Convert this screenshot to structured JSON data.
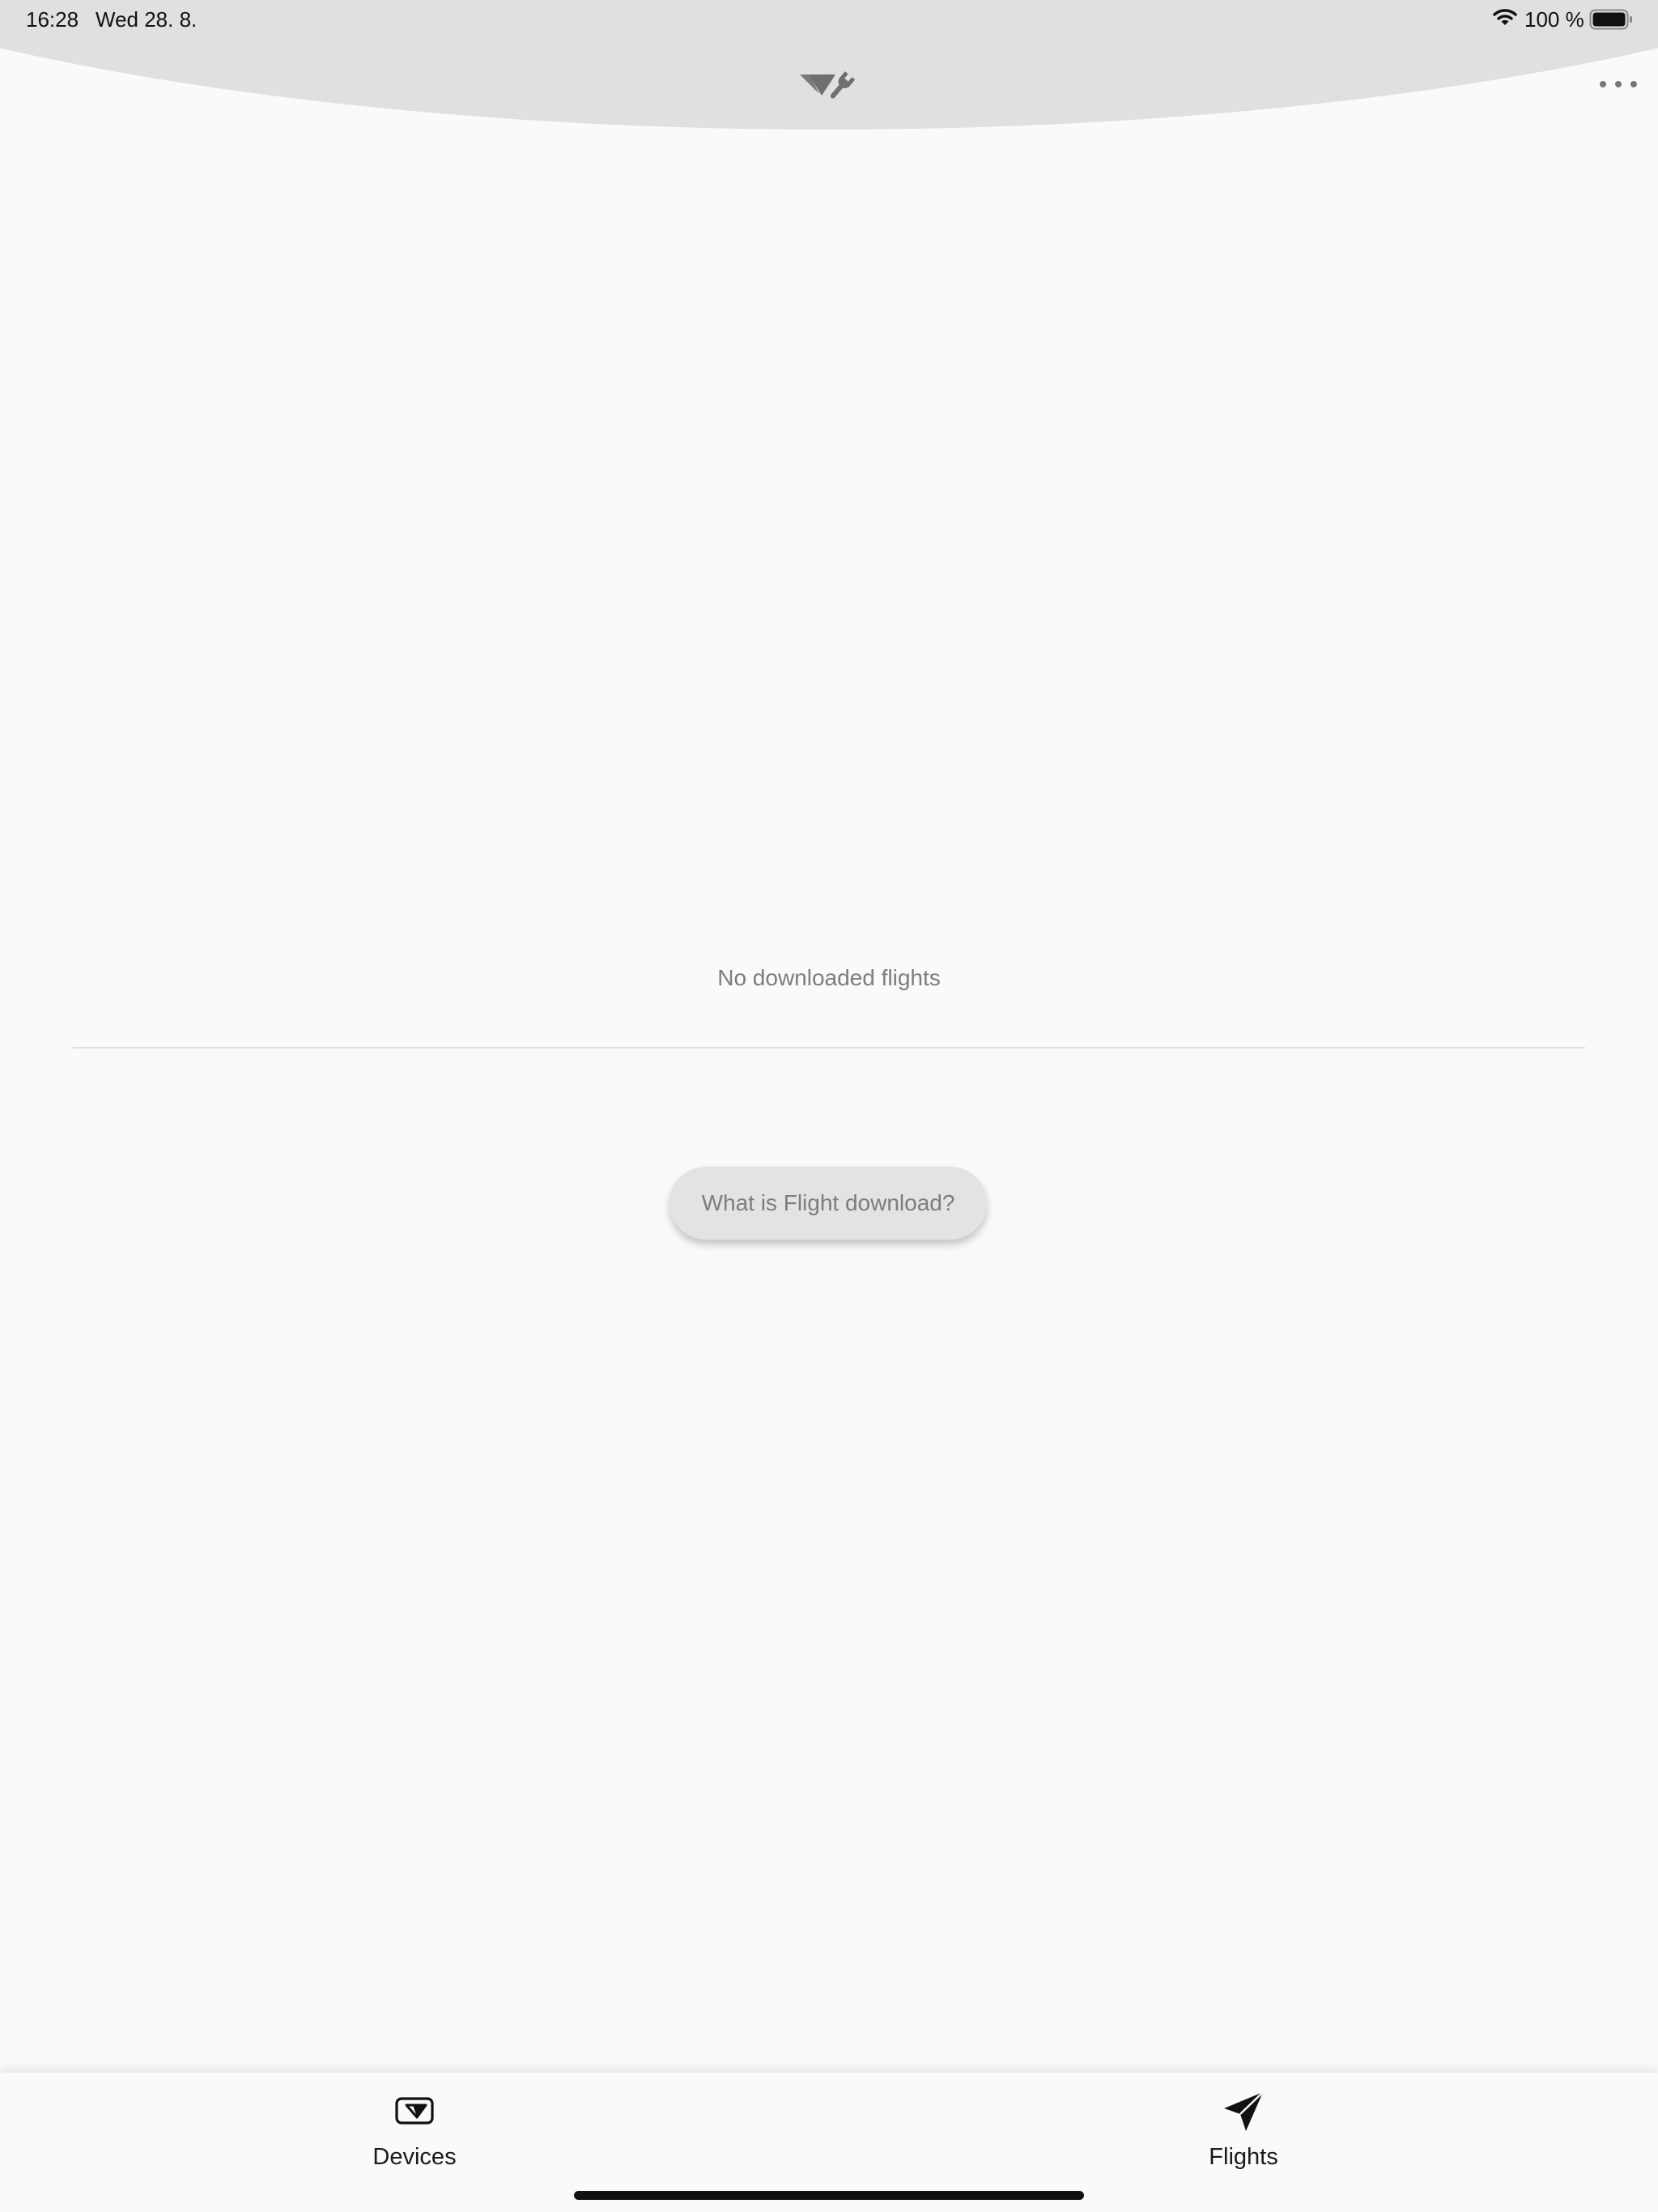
{
  "status_bar": {
    "time": "16:28",
    "date": "Wed 28. 8.",
    "battery": "100 %"
  },
  "header": {
    "logo_icon": "vario-wrench-logo-icon",
    "more_icon": "more-horizontal-icon"
  },
  "main": {
    "empty_message": "No downloaded flights",
    "help_button_label": "What is Flight download?"
  },
  "tab_bar": {
    "tabs": [
      {
        "label": "Devices",
        "icon": "device-icon"
      },
      {
        "label": "Flights",
        "icon": "paper-plane-icon"
      }
    ]
  },
  "colors": {
    "background": "#fafafa",
    "header_arc": "#e0e0e0",
    "muted_text": "#7d7d7d",
    "button_bg": "#e3e3e3"
  }
}
